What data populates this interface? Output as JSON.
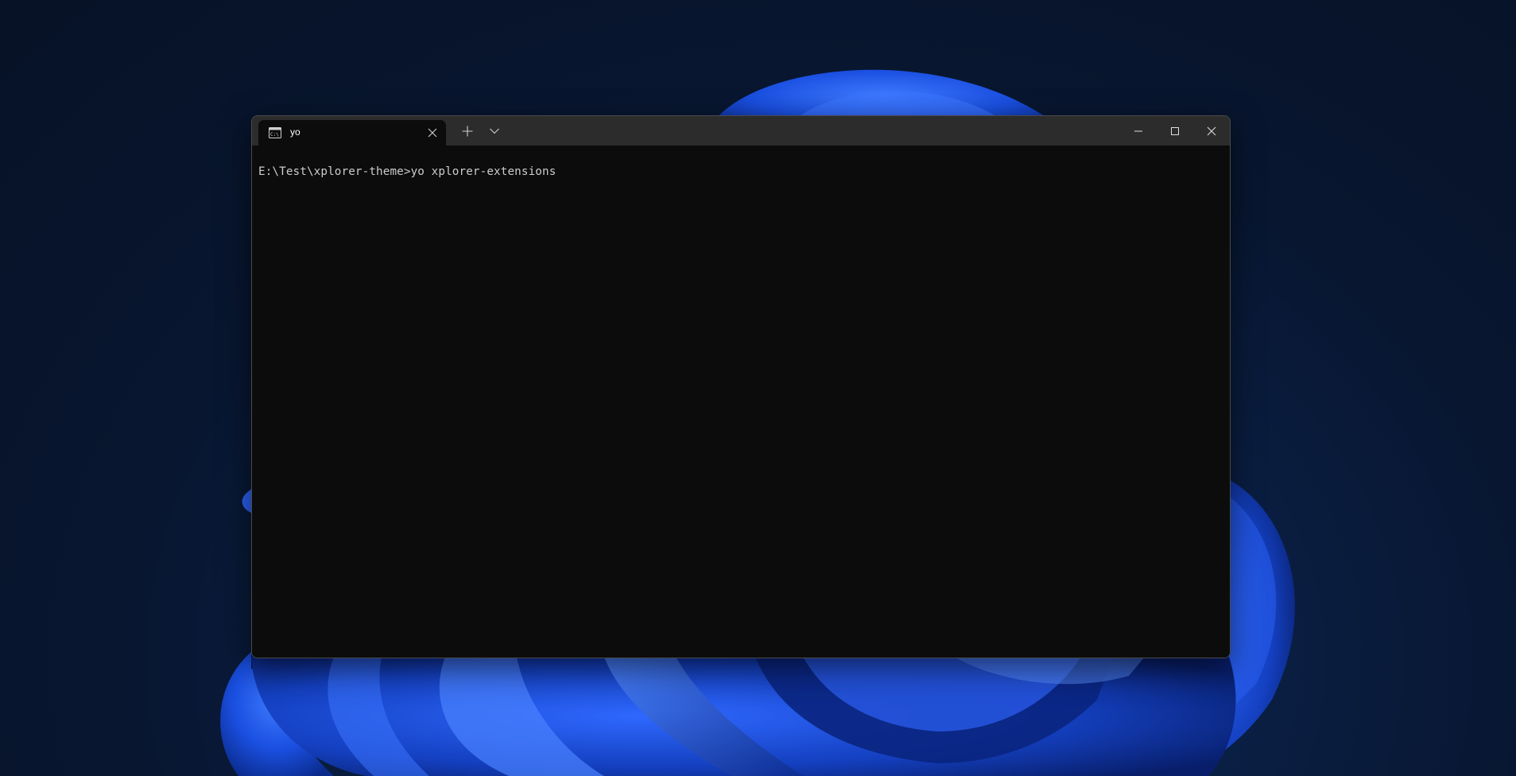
{
  "desktop": {
    "wallpaper_name": "windows-11-bloom-wallpaper",
    "background_color": "#0a1f44",
    "accent_color": "#1f5cff"
  },
  "window": {
    "tab": {
      "title": "yo",
      "icon": "command-prompt-icon",
      "close_icon": "close-icon"
    },
    "new_tab_icon": "plus-icon",
    "dropdown_icon": "chevron-down-icon",
    "controls": {
      "minimize_icon": "minimize-icon",
      "maximize_icon": "maximize-icon",
      "close_icon": "close-icon"
    },
    "titlebar_color": "#2c2c2c",
    "terminal_background": "#0c0c0c",
    "terminal_foreground": "#cccccc"
  },
  "terminal": {
    "lines": [
      "E:\\Test\\xplorer-theme>yo xplorer-extensions"
    ]
  }
}
